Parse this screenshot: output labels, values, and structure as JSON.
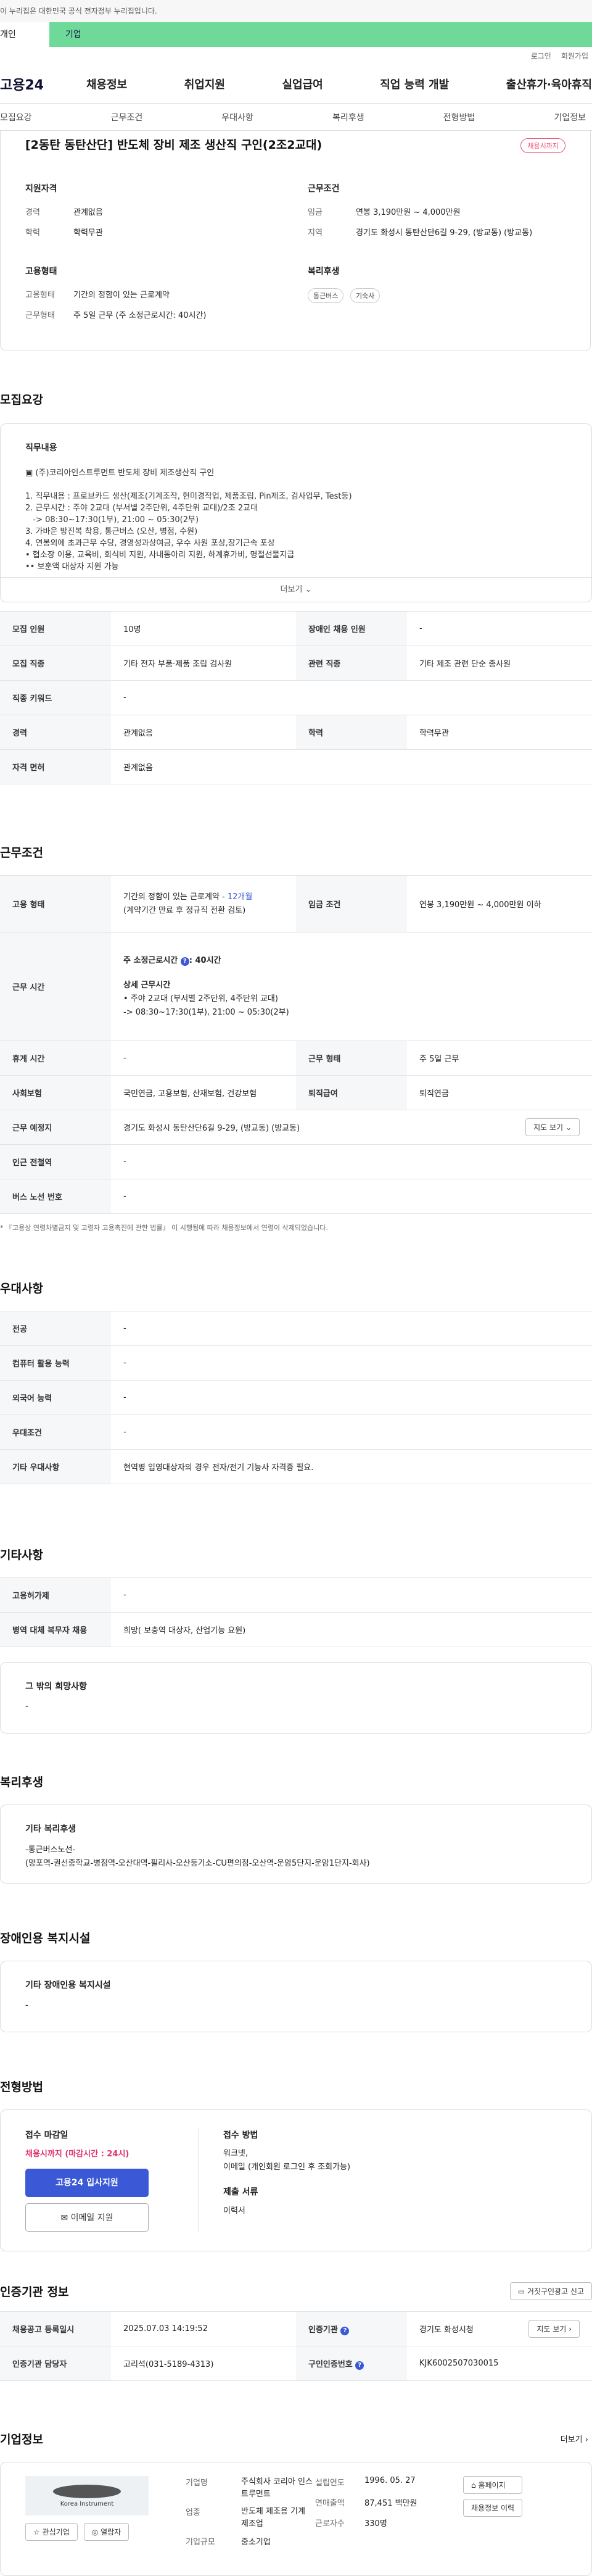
{
  "topbar": {
    "notice": "이 누리집은 대한민국 공식 전자정부 누리집입니다."
  },
  "usertabs": {
    "personal": "개인",
    "company": "기업"
  },
  "utility": {
    "login": "로그인",
    "join": "회원가입"
  },
  "gnb": {
    "logo": "고용24",
    "menu": [
      "채용정보",
      "취업지원",
      "실업급여",
      "직업 능력 개발",
      "출산휴가·육아휴직"
    ]
  },
  "anchors": [
    "모집요강",
    "근무조건",
    "우대사항",
    "복리후생",
    "전형방법",
    "기업정보"
  ],
  "header": {
    "title": "[2동탄 동탄산단] 반도체 장비 제조 생산직 구인(2조2교대)",
    "status_badge": "채용시까지",
    "qual": {
      "title": "지원자격",
      "career_k": "경력",
      "career_v": "관계없음",
      "edu_k": "학력",
      "edu_v": "학력무관"
    },
    "work": {
      "title": "근무조건",
      "wage_k": "임금",
      "wage_v": "연봉 3,190만원 ~ 4,000만원",
      "loc_k": "지역",
      "loc_v": "경기도 화성시 동탄산단6길 9-29, (방교동) (방교동)"
    },
    "emp": {
      "title": "고용형태",
      "type_k": "고용형태",
      "type_v": "기간의 정함이 있는 근로계약",
      "form_k": "근무형태",
      "form_v": "주 5일 근무 (주 소정근로시간: 40시간)"
    },
    "welfare": {
      "title": "복리후생",
      "chips": [
        "통근버스",
        "기숙사"
      ]
    }
  },
  "recruit": {
    "section_title": "모집요강",
    "box_label": "직무내용",
    "text": "▣ (주)코리아인스트루먼트 반도체 장비 제조생산직 구인\n\n1. 직무내용 : 프로브카드 생산(제조(기계조작, 현미경작업, 제품조립, Pin제조, 검사업무, Test등)\n2. 근무시간 : 주야 2교대 (부서별 2주단위, 4주단위 교대)/2조 2교대\n   -> 08:30~17:30(1부), 21:00 ~ 05:30(2부)\n3. 가바운 방진복 착용, 통근버스 (오산, 병점, 수원)\n4. 연봉외에 초과근무 수당, 경영성과상여금, 우수 사원 포상,장기근속 포상\n• 협소장 이용, 교육비, 회식비 지원, 사내동아리 지원, 하계휴가비, 명절선물지급\n•• 보훈액 대상자 지원 가능",
    "more": "더보기",
    "table": [
      [
        "모집 인원",
        "10명",
        "장애인 채용 인원",
        "-"
      ],
      [
        "모집 직종",
        "기타 전자 부품·제품 조립 검사원",
        "관련 직종",
        "기타 제조 관련 단순 종사원"
      ],
      [
        "직종 키워드",
        "-",
        "",
        ""
      ],
      [
        "경력",
        "관계없음",
        "학력",
        "학력무관"
      ],
      [
        "자격 면허",
        "관계없음",
        "",
        ""
      ]
    ]
  },
  "conditions": {
    "section_title": "근무조건",
    "emp_type_k": "고용 형태",
    "emp_type_v1": "기간의 정함이 있는 근로계약 - ",
    "emp_type_period": "12개월",
    "emp_type_v2": "(계약기간 만료 후 정규직 전환 검토)",
    "wage_k": "임금 조건",
    "wage_v": "연봉 3,190만원 ~ 4,000만원 이하",
    "hours_k": "근무 시간",
    "hours_main": "주 소정근로시간",
    "hours_main_v": ": 40시간",
    "hours_detail_title": "상세 근무시간",
    "hours_detail_1": "• 주야 2교대 (부서별 2주단위, 4주단위 교대)",
    "hours_detail_2": "-> 08:30~17:30(1부), 21:00 ~ 05:30(2부)",
    "rest_k": "휴게 시간",
    "rest_v": "-",
    "form_k": "근무 형태",
    "form_v": "주 5일 근무",
    "ins_k": "사회보험",
    "ins_v": "국민연금, 고용보험, 산재보험, 건강보험",
    "sev_k": "퇴직급여",
    "sev_v": "퇴직연금",
    "loc_k": "근무 예정지",
    "loc_v": "경기도 화성시 동탄산단6길 9-29, (방교동) (방교동)",
    "map_btn": "지도 보기",
    "sub_k": "인근 전철역",
    "sub_v": "-",
    "bus_k": "버스 노선 번호",
    "bus_v": "-",
    "note": "* 『고용상 연령차별금지 및 고령자 고용촉진에 관한 법률』 이 시행됨에 따라 채용정보에서 연령이 삭제되었습니다."
  },
  "preference": {
    "section_title": "우대사항",
    "rows": [
      [
        "전공",
        "-"
      ],
      [
        "컴퓨터 활용 능력",
        "-"
      ],
      [
        "외국어 능력",
        "-"
      ],
      [
        "우대조건",
        "-"
      ],
      [
        "기타 우대사항",
        "현역병 입영대상자의 경우 전자/전기 기능사 자격증 필요."
      ]
    ]
  },
  "etc": {
    "section_title": "기타사항",
    "rows": [
      [
        "고용허가제",
        "-"
      ],
      [
        "병역 대체 복무자 채용",
        "희망( 보충역 대상자, 산업기능 요원)"
      ]
    ],
    "box_title": "그 밖의 희망사항",
    "box_value": "-"
  },
  "welfare": {
    "section_title": "복리후생",
    "box_title": "기타 복리후생",
    "line1": "-통근버스노선-",
    "line2": "(망포역-권선중학교-병점역-오산대역-필리사-오산등기소-CU편의점-오산역-운암5단지-운암1단지-회사)"
  },
  "disabled": {
    "section_title": "장애인용 복지시설",
    "box_title": "기타 장애인용 복지시설",
    "box_value": "-"
  },
  "process": {
    "section_title": "전형방법",
    "deadline_title": "접수 마감일",
    "deadline_value": "채용시까지 (마감시간 : 24시)",
    "apply_btn": "고용24 입사지원",
    "email_btn": "이메일 지원",
    "method_title": "접수 방법",
    "method_1": "워크넷,",
    "method_2": "이메일 (개인회원 로그인 후 조회가능)",
    "docs_title": "제출 서류",
    "docs_value": "이력서"
  },
  "cert": {
    "section_title": "인증기관 정보",
    "report_btn": "거짓구인광고 신고",
    "rows": [
      [
        "채용공고 등록일시",
        "2025.07.03 14:19:52",
        "인증기관",
        "경기도 화성시청"
      ],
      [
        "인증기관 담당자",
        "고리석(031-5189-4313)",
        "구인인증번호",
        "KJK6002507030015"
      ]
    ],
    "map_btn": "지도 보기"
  },
  "company": {
    "section_title": "기업정보",
    "more": "더보기",
    "logo_text": "Korea Instrument",
    "interest_btn": "관심기업",
    "visit_btn": "열람자",
    "name_k": "기업명",
    "name_v": "주식회사 코리아 인스트루먼트",
    "industry_k": "업종",
    "industry_v": "반도체 제조용 기계 제조업",
    "scale_k": "기업규모",
    "scale_v": "중소기업",
    "founded_k": "설립연도",
    "founded_v": "1996. 05. 27",
    "sales_k": "연매출액",
    "sales_v": "87,451 백만원",
    "staff_k": "근로자수",
    "staff_v": "330명",
    "homepage_btn": "홈페이지",
    "jobs_btn": "채용정보 이력"
  }
}
